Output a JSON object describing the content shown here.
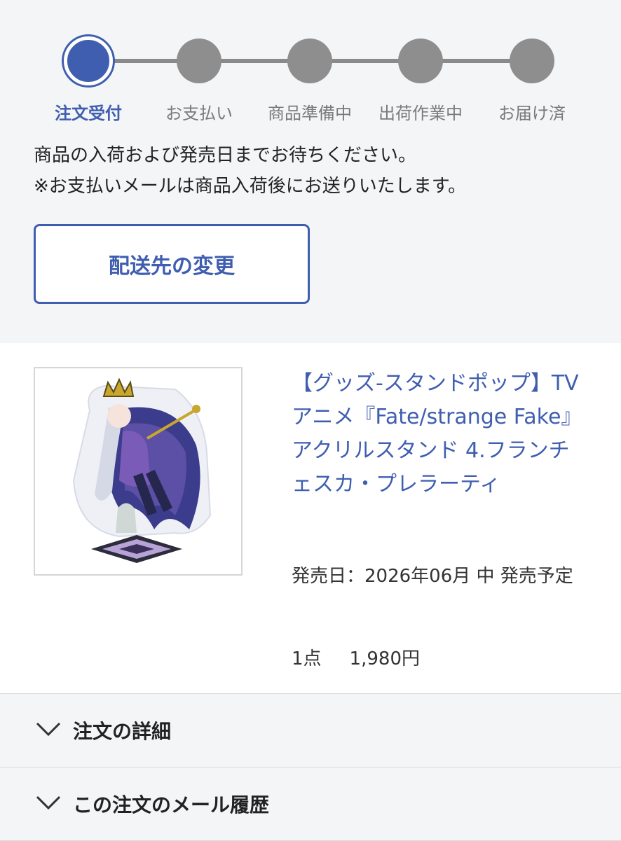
{
  "steps": [
    {
      "label": "注文受付",
      "state": "active"
    },
    {
      "label": "お支払い",
      "state": "pending"
    },
    {
      "label": "商品準備中",
      "state": "pending"
    },
    {
      "label": "出荷作業中",
      "state": "pending"
    },
    {
      "label": "お届け済",
      "state": "pending"
    }
  ],
  "notice": {
    "line1": "商品の入荷および発売日までお待ちください。",
    "line2": "※お支払いメールは商品入荷後にお送りいたします。"
  },
  "change_address_button": "配送先の変更",
  "product": {
    "title": "【グッズ-スタンドポップ】TVアニメ『Fate/strange Fake』 アクリルスタンド 4.フランチェスカ・プレラーティ",
    "release": "発売日：2026年06月 中 発売予定",
    "quantity": "1点",
    "price": "1,980円",
    "image_icon": "acrylic-stand-image"
  },
  "accordions": {
    "order_detail": "注文の詳細",
    "mail_history": "この注文のメール履歴"
  },
  "colors": {
    "accent": "#3f5eb0",
    "inactive_step": "#8e8e8e",
    "background": "#f4f5f7"
  }
}
